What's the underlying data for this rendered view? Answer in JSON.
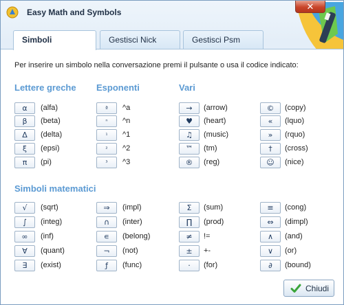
{
  "window": {
    "title": "Easy Math and Symbols",
    "close_glyph": "✕"
  },
  "tabs": [
    {
      "label": "Simboli",
      "active": true
    },
    {
      "label": "Gestisci Nick",
      "active": false
    },
    {
      "label": "Gestisci Psm",
      "active": false
    }
  ],
  "instructions": "Per inserire un simbolo nella conversazione premi il pulsante o usa il codice indicato:",
  "sections": {
    "greek": "Lettere greche",
    "exponents": "Esponenti",
    "misc": "Vari",
    "math": "Simboli matematici"
  },
  "greek": [
    {
      "symbol": "α",
      "code": "(alfa)"
    },
    {
      "symbol": "β",
      "code": "(beta)"
    },
    {
      "symbol": "Δ",
      "code": "(delta)"
    },
    {
      "symbol": "ξ",
      "code": "(epsi)"
    },
    {
      "symbol": "π",
      "code": "(pi)"
    }
  ],
  "exponents": [
    {
      "symbol": "ª",
      "code": "^a"
    },
    {
      "symbol": "ⁿ",
      "code": "^n"
    },
    {
      "symbol": "¹",
      "code": "^1"
    },
    {
      "symbol": "²",
      "code": "^2"
    },
    {
      "symbol": "³",
      "code": "^3"
    }
  ],
  "misc": [
    {
      "symbol": "→",
      "code": "(arrow)"
    },
    {
      "symbol": "♥",
      "code": "(heart)"
    },
    {
      "symbol": "♫",
      "code": "(music)"
    },
    {
      "symbol": "™",
      "code": "(tm)"
    },
    {
      "symbol": "®",
      "code": "(reg)"
    }
  ],
  "misc2": [
    {
      "symbol": "©",
      "code": "(copy)"
    },
    {
      "symbol": "«",
      "code": "(lquo)"
    },
    {
      "symbol": "»",
      "code": "(rquo)"
    },
    {
      "symbol": "†",
      "code": "(cross)"
    },
    {
      "symbol": "☺",
      "code": "(nice)"
    }
  ],
  "math_col1": [
    {
      "symbol": "√",
      "code": "(sqrt)"
    },
    {
      "symbol": "∫",
      "code": "(integ)"
    },
    {
      "symbol": "∞",
      "code": "(inf)"
    },
    {
      "symbol": "∀",
      "code": "(quant)"
    },
    {
      "symbol": "∃",
      "code": "(exist)"
    }
  ],
  "math_col2": [
    {
      "symbol": "⇒",
      "code": "(impl)"
    },
    {
      "symbol": "∩",
      "code": "(inter)"
    },
    {
      "symbol": "∊",
      "code": "(belong)"
    },
    {
      "symbol": "¬",
      "code": "(not)"
    },
    {
      "symbol": "ƒ",
      "code": "(func)"
    }
  ],
  "math_col3": [
    {
      "symbol": "Σ",
      "code": "(sum)"
    },
    {
      "symbol": "∏",
      "code": "(prod)"
    },
    {
      "symbol": "≠",
      "code": "!="
    },
    {
      "symbol": "±",
      "code": "+-"
    },
    {
      "symbol": "·",
      "code": "(for)"
    }
  ],
  "math_col4": [
    {
      "symbol": "≡",
      "code": "(cong)"
    },
    {
      "symbol": "⇔",
      "code": "(dimpl)"
    },
    {
      "symbol": "∧",
      "code": "(and)"
    },
    {
      "symbol": "∨",
      "code": "(or)"
    },
    {
      "symbol": "∂",
      "code": "(bound)"
    }
  ],
  "close_button": {
    "label": "Chiudi"
  }
}
